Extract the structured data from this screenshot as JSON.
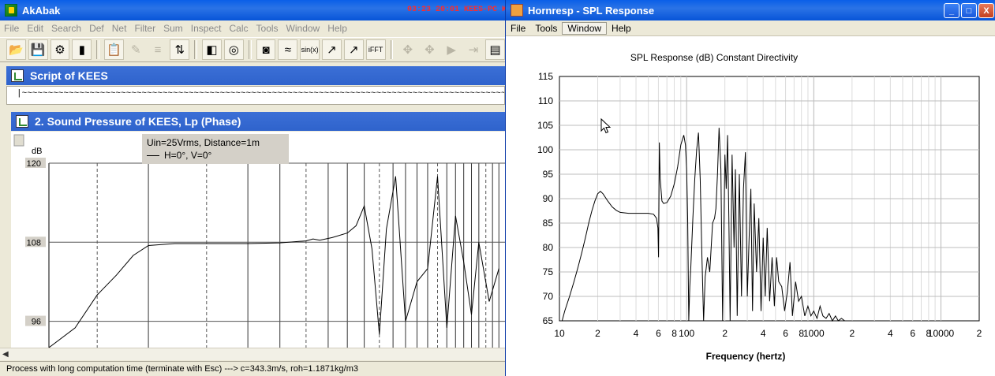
{
  "akabak": {
    "title": "AkAbak",
    "overlay_clock": "03:23  20:01  KEES-PC  Kees  Screenshots",
    "menu": [
      "File",
      "Edit",
      "Search",
      "Def",
      "Net",
      "Filter",
      "Sum",
      "Inspect",
      "Calc",
      "Tools",
      "Window",
      "Help"
    ],
    "toolbar": {
      "sinx_label": "sin(x)",
      "ifft_label": "iFFT"
    },
    "script_panel": {
      "title": "Script of KEES",
      "content": "|~~~~~~~~~~~~~~~~~~~~~~~~~~~~~~~~~~~~~~~~~~~~~~~~~~~~~~~~~~~~~~~~~~~~~~~~~~~~~~~~~~~~~~~~~~~~~~~~~~~~"
    },
    "sound_panel": {
      "title": "2. Sound Pressure of KEES, Lp (Phase)"
    },
    "status": "Process with long computation time (terminate with Esc) ---> c=343.3m/s, roh=1.1871kg/m3"
  },
  "hornresp": {
    "title": "Hornresp - SPL Response",
    "menu": [
      "File",
      "Tools",
      "Window",
      "Help"
    ],
    "window_buttons": {
      "minimize": "_",
      "maximize": "□",
      "close": "X"
    }
  },
  "chart_data": [
    {
      "type": "line",
      "title": "Uin=25Vrms, Distance=1m",
      "ylabel": "dB",
      "y_ticks": [
        96,
        108,
        120
      ],
      "ylim": [
        92,
        120
      ],
      "x_scale": "log",
      "legend": [
        {
          "name": "H=0°, V=0°",
          "color": "#000000"
        }
      ],
      "legend_position": "top-left",
      "grid": true,
      "series": [
        {
          "name": "H=0°, V=0°",
          "x": [
            10,
            12,
            14,
            16,
            18,
            20,
            24,
            30,
            40,
            50,
            60,
            63,
            66,
            72,
            80,
            85,
            90,
            95,
            100,
            105,
            112,
            120,
            130,
            140,
            150,
            160,
            170,
            180,
            190,
            200,
            215,
            230
          ],
          "y": [
            92,
            95,
            100,
            103,
            106,
            107.5,
            107.8,
            107.8,
            107.8,
            107.9,
            108.2,
            108.5,
            108.3,
            108.7,
            109.4,
            110.5,
            113.5,
            107,
            94,
            110,
            118,
            96,
            102,
            104,
            118,
            95,
            112,
            105,
            97,
            108,
            99,
            104
          ]
        }
      ]
    },
    {
      "type": "line",
      "title": "SPL Response (dB)    Constant Directivity",
      "xlabel": "Frequency (hertz)",
      "ylabel": "",
      "x_scale": "log",
      "xlim": [
        10,
        20000
      ],
      "ylim": [
        65,
        115
      ],
      "x_tick_labels": [
        "10",
        "2",
        "4",
        "6",
        "8",
        "100",
        "2",
        "4",
        "6",
        "8",
        "1000",
        "2",
        "4",
        "6",
        "8",
        "10000",
        "2"
      ],
      "y_ticks": [
        65,
        70,
        75,
        80,
        85,
        90,
        95,
        100,
        105,
        110,
        115
      ],
      "grid": true,
      "series": [
        {
          "x": [
            10.5,
            11,
            12,
            13,
            14,
            15,
            16,
            17,
            18,
            19,
            20,
            21,
            22,
            24,
            26,
            28,
            30,
            35,
            40,
            45,
            50,
            55,
            58,
            59.5,
            60.2,
            61,
            62,
            64,
            66,
            70,
            75,
            80,
            85,
            90,
            95,
            98,
            100,
            102,
            104,
            106,
            108,
            112,
            116,
            120,
            124,
            128,
            132,
            136,
            140,
            146,
            152,
            160,
            166,
            170,
            175,
            180,
            186,
            192,
            200,
            205,
            210,
            215,
            220,
            228,
            236,
            242,
            250,
            260,
            270,
            280,
            290,
            300,
            310,
            320,
            330,
            340,
            355,
            370,
            385,
            400,
            415,
            430,
            450,
            470,
            490,
            510,
            530,
            560,
            590,
            620,
            650,
            680,
            720,
            760,
            800,
            850,
            900,
            950,
            1000,
            1060,
            1120,
            1180,
            1250,
            1320,
            1400,
            1480,
            1560,
            1650,
            1750,
            1850,
            1950,
            2000
          ],
          "y": [
            65,
            67,
            70,
            73,
            76,
            79,
            82,
            85,
            87.5,
            89.5,
            91,
            91.5,
            91,
            89.5,
            88.3,
            87.6,
            87.2,
            87,
            87,
            87,
            87,
            86.8,
            86,
            84,
            78,
            101.5,
            94,
            89.5,
            89,
            89.2,
            90.5,
            93,
            96.5,
            101,
            103,
            101,
            96,
            86,
            65,
            72,
            76,
            86,
            94,
            100,
            103.5,
            94,
            78,
            65,
            74,
            78,
            75,
            85,
            86,
            88,
            95,
            104.5,
            96,
            65,
            99,
            92,
            103,
            86,
            65,
            99,
            80,
            96,
            66,
            95,
            70,
            92,
            99.5,
            70,
            82,
            92,
            67,
            89,
            75,
            86,
            67,
            82,
            70,
            84,
            69,
            78,
            68,
            78,
            73,
            72,
            67,
            71,
            77,
            66,
            73,
            69,
            70,
            66,
            68,
            66,
            67,
            65.5,
            68,
            66,
            65.5,
            66.5,
            65,
            66,
            65,
            65.5,
            65,
            65,
            65,
            65
          ]
        }
      ]
    }
  ]
}
